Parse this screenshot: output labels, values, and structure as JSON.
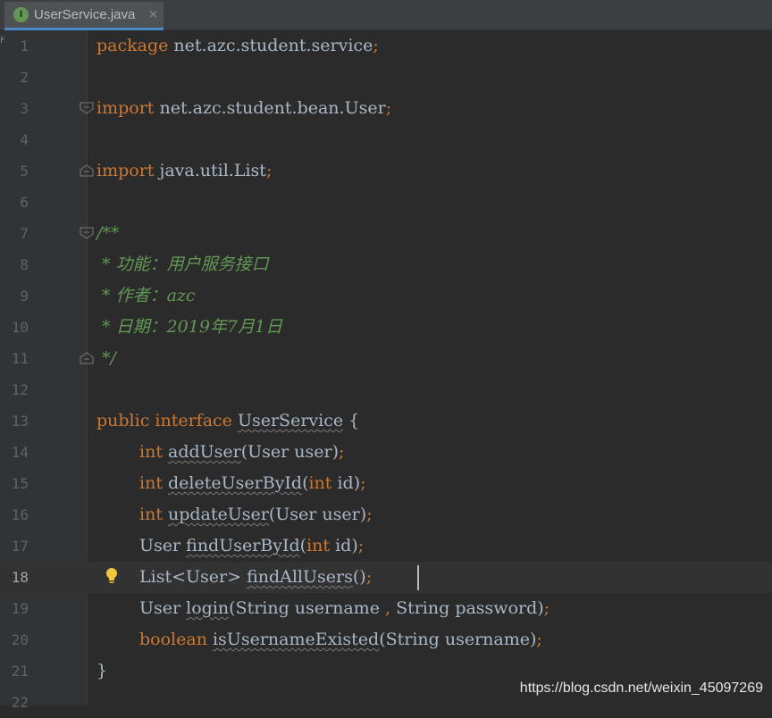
{
  "tab": {
    "icon_letter": "I",
    "file_name": "UserService.java",
    "close_glyph": "×"
  },
  "gutter_mark": "F",
  "lines": [
    {
      "n": "1"
    },
    {
      "n": "2"
    },
    {
      "n": "3"
    },
    {
      "n": "4"
    },
    {
      "n": "5"
    },
    {
      "n": "6"
    },
    {
      "n": "7"
    },
    {
      "n": "8"
    },
    {
      "n": "9"
    },
    {
      "n": "10"
    },
    {
      "n": "11"
    },
    {
      "n": "12"
    },
    {
      "n": "13"
    },
    {
      "n": "14"
    },
    {
      "n": "15"
    },
    {
      "n": "16"
    },
    {
      "n": "17"
    },
    {
      "n": "18"
    },
    {
      "n": "19"
    },
    {
      "n": "20"
    },
    {
      "n": "21"
    },
    {
      "n": "22"
    }
  ],
  "code": {
    "l1": {
      "kw": "package",
      "name": " net.azc.student.service",
      "semi": ";"
    },
    "l3": {
      "kw": "import",
      "name": " net.azc.student.bean.User",
      "semi": ";"
    },
    "l5": {
      "kw": "import",
      "name": " java.util.List",
      "semi": ";"
    },
    "l7": "/**",
    "l8": " * 功能：用户服务接口",
    "l9": " * 作者：azc",
    "l10": " * 日期：2019年7月1日",
    "l11": " */",
    "l13": {
      "kw": "public interface",
      "name": "UserService",
      "brace": " {"
    },
    "l14": {
      "type": "int",
      "method": "addUser",
      "params": "(User user)",
      "semi": ";"
    },
    "l15": {
      "type": "int",
      "method": "deleteUserById",
      "p_open": "(",
      "p_type": "int",
      "p_rest": " id)",
      "semi": ";"
    },
    "l16": {
      "type": "int",
      "method": "updateUser",
      "params": "(User user)",
      "semi": ";"
    },
    "l17": {
      "type": "User",
      "method": "findUserById",
      "p_open": "(",
      "p_type": "int",
      "p_rest": " id)",
      "semi": ";"
    },
    "l18": {
      "type": "List<User>",
      "method": "findAllUsers",
      "params": "()",
      "semi": ";"
    },
    "l19": {
      "type": "User",
      "method": "login",
      "p_open": "(String username ",
      "p_comma": ",",
      "p_rest": " String password)",
      "semi": ";"
    },
    "l20": {
      "type": "boolean",
      "method": "isUsernameExisted",
      "params": "(String username)",
      "semi": ";"
    },
    "l21": "}",
    "l22": ""
  },
  "watermark": "https://blog.csdn.net/weixin_45097269",
  "colors": {
    "background": "#2b2b2b",
    "keyword": "#cc7832",
    "comment": "#629755",
    "text": "#a9b7c6",
    "line_number": "#606366",
    "tab_underline": "#4a88c7"
  },
  "icons": {
    "fold": "fold-marker-icon",
    "bulb": "lightbulb-icon",
    "interface": "interface-file-icon"
  }
}
